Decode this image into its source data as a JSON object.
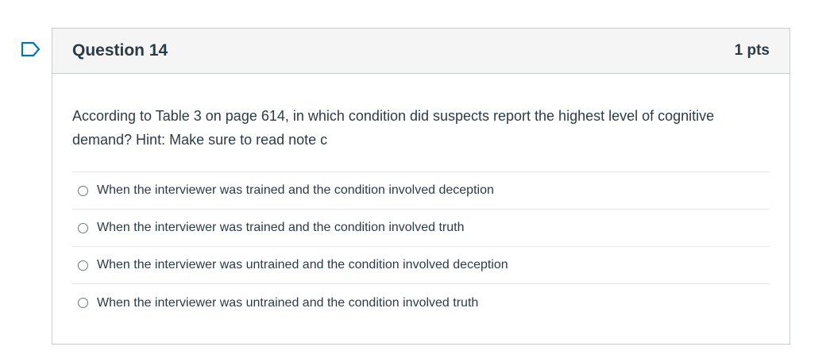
{
  "question": {
    "title": "Question 14",
    "points": "1 pts",
    "text": "According to Table 3 on page 614, in which condition did suspects report the highest level of cognitive demand? Hint: Make sure to read note c",
    "flag_icon": "flag-outline-icon",
    "accent_color": "#0374b5"
  },
  "answers": [
    {
      "label": "When the interviewer was trained and the condition involved deception",
      "selected": false
    },
    {
      "label": "When the interviewer was trained and the condition involved truth",
      "selected": false
    },
    {
      "label": "When the interviewer was untrained and the condition involved deception",
      "selected": false
    },
    {
      "label": "When the interviewer was untrained and the condition involved truth",
      "selected": false
    }
  ]
}
